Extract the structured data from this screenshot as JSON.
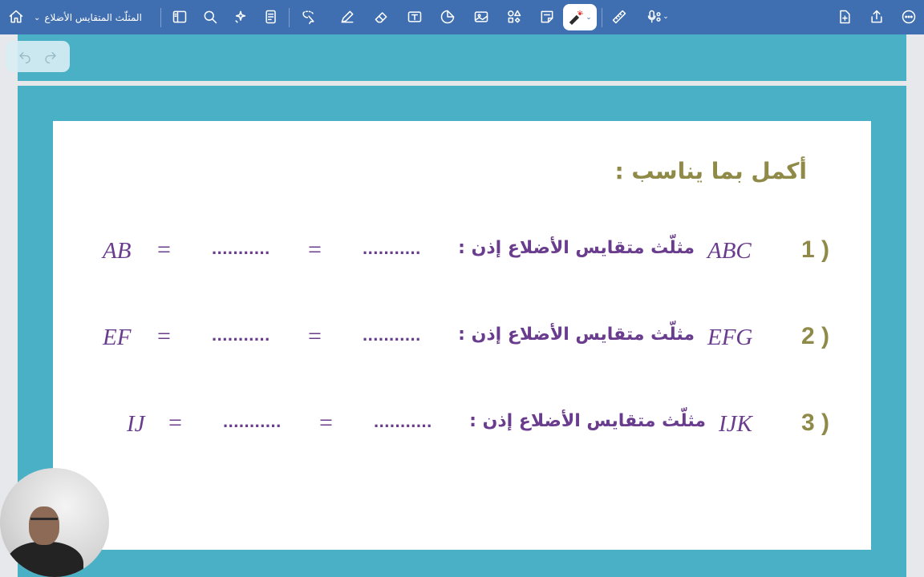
{
  "toolbar": {
    "doc_title": "المثلّث المتقايس الأضلاع",
    "icons": [
      "home-icon",
      "sidebar-icon",
      "search-icon",
      "ai-sparkle-icon",
      "page-template-icon",
      "lasso-select-icon",
      "pen-icon",
      "eraser-icon",
      "text-box-icon",
      "sticker-icon",
      "image-icon",
      "shapes-icon",
      "sticky-note-icon",
      "laser-pointer-icon",
      "ruler-icon",
      "microphone-icon",
      "add-page-icon",
      "share-icon",
      "more-icon"
    ]
  },
  "slide": {
    "heading": "أكمل بما يناسب :",
    "rows": [
      {
        "num": "1 )",
        "triangle": "ABC",
        "text": "مثلّث متقايس الأضلاع إذن :",
        "dots1": "...........",
        "eq1": "=",
        "dots2": "...........",
        "eq2": "=",
        "side": "AB"
      },
      {
        "num": "2 )",
        "triangle": "EFG",
        "text": "مثلّث متقايس الأضلاع إذن :",
        "dots1": "...........",
        "eq1": "=",
        "dots2": "...........",
        "eq2": "=",
        "side": "EF"
      },
      {
        "num": "3 )",
        "triangle": "IJK",
        "text": "مثلّث متقايس الأضلاع إذن :",
        "dots1": "...........",
        "eq1": "=",
        "dots2": "...........",
        "eq2": "=",
        "side": "IJ"
      }
    ]
  },
  "colors": {
    "toolbar": "#3f6fb1",
    "page_border": "#4ab0c6",
    "heading": "#8f8a47",
    "math_text": "#6a3c8e"
  }
}
